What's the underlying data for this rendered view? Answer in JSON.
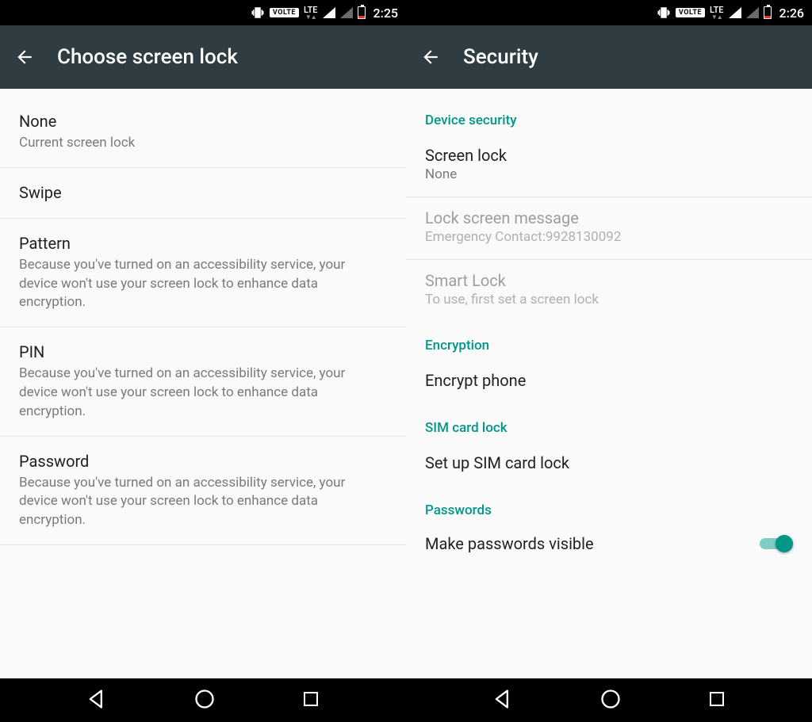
{
  "left": {
    "status": {
      "volte": "VOLTE",
      "net": "LTE",
      "clock": "2:25"
    },
    "title": "Choose screen lock",
    "items": [
      {
        "primary": "None",
        "secondary": "Current screen lock"
      },
      {
        "primary": "Swipe"
      },
      {
        "primary": "Pattern",
        "secondary": "Because you've turned on an accessibility service, your device won't use your screen lock to enhance data encryption."
      },
      {
        "primary": "PIN",
        "secondary": "Because you've turned on an accessibility service, your device won't use your screen lock to enhance data encryption."
      },
      {
        "primary": "Password",
        "secondary": "Because you've turned on an accessibility service, your device won't use your screen lock to enhance data encryption."
      }
    ]
  },
  "right": {
    "status": {
      "volte": "VOLTE",
      "net": "LTE",
      "clock": "2:26"
    },
    "title": "Security",
    "sections": {
      "device_security": {
        "header": "Device security",
        "screen_lock": {
          "primary": "Screen lock",
          "secondary": "None"
        },
        "lock_message": {
          "primary": "Lock screen message",
          "secondary": "Emergency Contact:9928130092"
        },
        "smart_lock": {
          "primary": "Smart Lock",
          "secondary": "To use, first set a screen lock"
        }
      },
      "encryption": {
        "header": "Encryption",
        "encrypt_phone": {
          "primary": "Encrypt phone"
        }
      },
      "sim": {
        "header": "SIM card lock",
        "setup_sim": {
          "primary": "Set up SIM card lock"
        }
      },
      "passwords": {
        "header": "Passwords",
        "visible": {
          "primary": "Make passwords visible",
          "on": true
        }
      }
    }
  }
}
